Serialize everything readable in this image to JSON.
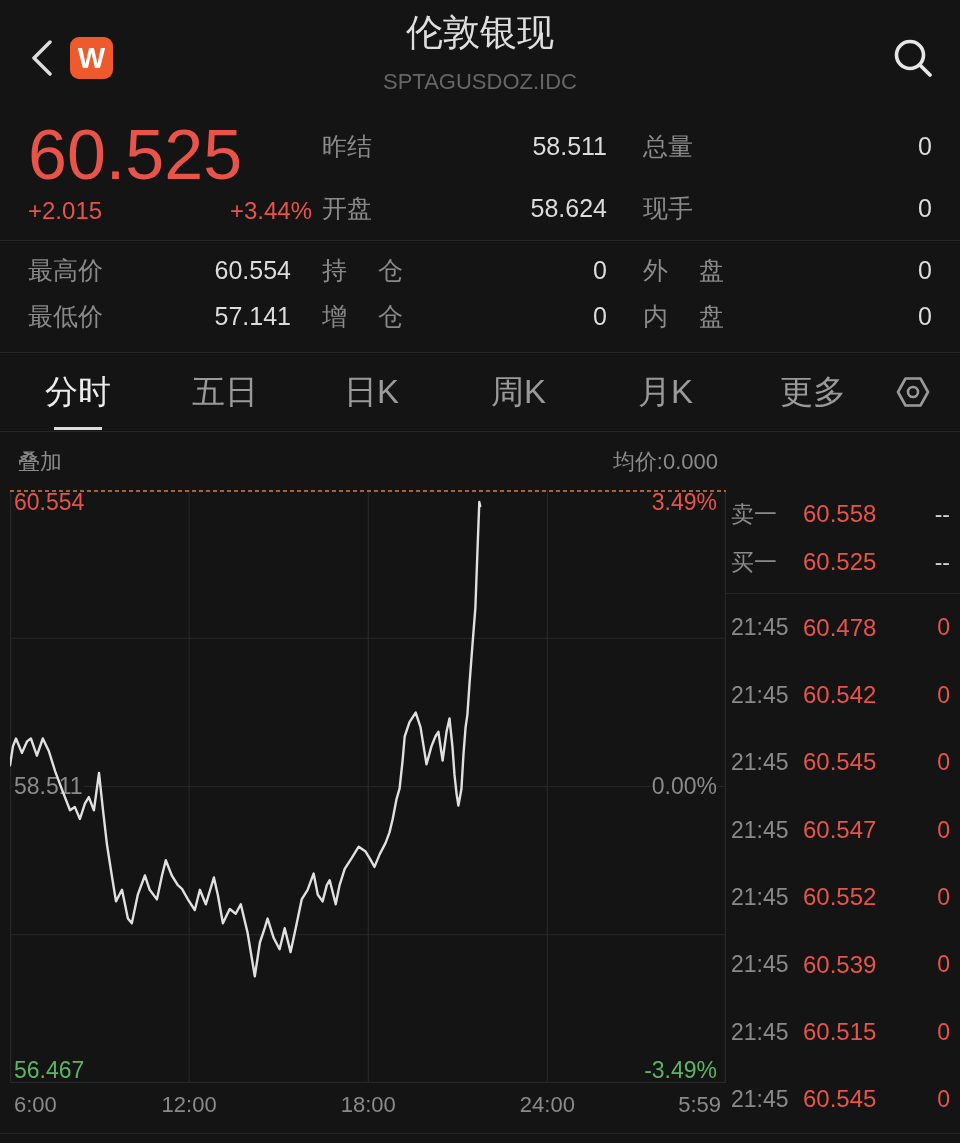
{
  "header": {
    "title": "伦敦银现",
    "subtitle": "SPTAGUSDOZ.IDC",
    "logo_text": "W"
  },
  "quote": {
    "price": "60.525",
    "change": "+2.015",
    "change_percent": "+3.44%",
    "stats": [
      [
        {
          "label": "昨结",
          "value": "58.511"
        },
        {
          "label": "总量",
          "value": "0"
        }
      ],
      [
        {
          "label": "开盘",
          "value": "58.624"
        },
        {
          "label": "现手",
          "value": "0"
        }
      ]
    ]
  },
  "range_stats": [
    [
      {
        "label": "最高价",
        "value": "60.554"
      },
      {
        "label": "持 仓",
        "value": "0"
      },
      {
        "label": "外 盘",
        "value": "0"
      }
    ],
    [
      {
        "label": "最低价",
        "value": "57.141"
      },
      {
        "label": "增 仓",
        "value": "0"
      },
      {
        "label": "内 盘",
        "value": "0"
      }
    ]
  ],
  "tabs": [
    {
      "label": "分时",
      "selected": true
    },
    {
      "label": "五日",
      "selected": false
    },
    {
      "label": "日K",
      "selected": false
    },
    {
      "label": "周K",
      "selected": false
    },
    {
      "label": "月K",
      "selected": false
    },
    {
      "label": "更多",
      "selected": false
    }
  ],
  "chart": {
    "overlay_label": "叠加",
    "average": "均价:0.000",
    "percent_labels": [
      "3.49%",
      "0.00%",
      "-3.49%"
    ],
    "session_end_label": "5:59",
    "chart_data": {
      "type": "line",
      "x": [
        6.0,
        6.1,
        6.2,
        6.4,
        6.57,
        6.7,
        6.9,
        7.1,
        7.3,
        7.51,
        7.74,
        8.01,
        8.17,
        8.34,
        8.51,
        8.64,
        8.81,
        8.98,
        9.11,
        9.25,
        9.41,
        9.55,
        9.75,
        9.95,
        10.08,
        10.28,
        10.52,
        10.68,
        10.92,
        11.09,
        11.22,
        11.42,
        11.62,
        11.76,
        11.96,
        12.19,
        12.36,
        12.56,
        12.83,
        12.96,
        13.13,
        13.36,
        13.56,
        13.73,
        13.96,
        14.2,
        14.37,
        14.53,
        14.63,
        14.83,
        15.03,
        15.2,
        15.4,
        15.57,
        15.77,
        15.97,
        16.17,
        16.31,
        16.47,
        16.61,
        16.71,
        16.91,
        17.04,
        17.21,
        17.44,
        17.68,
        17.91,
        18.05,
        18.21,
        18.38,
        18.58,
        18.71,
        18.82,
        18.95,
        19.05,
        19.15,
        19.22,
        19.38,
        19.59,
        19.75,
        19.95,
        20.12,
        20.25,
        20.35,
        20.49,
        20.62,
        20.72,
        20.82,
        20.89,
        20.96,
        21.02,
        21.12,
        21.19,
        21.26,
        21.32,
        21.39,
        21.49,
        21.59,
        21.66,
        21.72,
        21.75
      ],
      "series": [
        {
          "color": "#e0e0e0",
          "values": [
            58.659,
            58.797,
            58.852,
            58.748,
            58.831,
            58.852,
            58.728,
            58.852,
            58.762,
            58.617,
            58.486,
            58.335,
            58.36,
            58.273,
            58.383,
            58.43,
            58.335,
            58.604,
            58.349,
            58.087,
            57.866,
            57.68,
            57.763,
            57.556,
            57.522,
            57.728,
            57.866,
            57.763,
            57.694,
            57.866,
            57.976,
            57.866,
            57.797,
            57.77,
            57.694,
            57.618,
            57.763,
            57.659,
            57.852,
            57.728,
            57.522,
            57.625,
            57.591,
            57.659,
            57.453,
            57.141,
            57.384,
            57.487,
            57.556,
            57.418,
            57.336,
            57.487,
            57.315,
            57.487,
            57.694,
            57.763,
            57.88,
            57.728,
            57.68,
            57.797,
            57.832,
            57.659,
            57.797,
            57.914,
            57.99,
            58.073,
            58.038,
            57.99,
            57.928,
            58.018,
            58.101,
            58.176,
            58.273,
            58.418,
            58.493,
            58.693,
            58.866,
            58.969,
            59.038,
            58.934,
            58.666,
            58.797,
            58.866,
            58.9,
            58.693,
            58.9,
            58.996,
            58.797,
            58.59,
            58.452,
            58.369,
            58.486,
            58.741,
            58.934,
            59.024,
            59.245,
            59.52,
            59.796,
            60.209,
            60.554,
            60.525
          ]
        }
      ],
      "xlim": [
        6,
        29.983
      ],
      "ylim": [
        56.373,
        60.64
      ],
      "grid": true,
      "xticks": [
        {
          "value": 6,
          "label": "6:00"
        },
        {
          "value": 12,
          "label": "12:00"
        },
        {
          "value": 18,
          "label": "18:00"
        },
        {
          "value": 24,
          "label": "24:00"
        }
      ],
      "yticks": [
        {
          "value": 56.467,
          "label": "56.467"
        },
        {
          "value": 58.511,
          "label": "58.511"
        },
        {
          "value": 60.554,
          "label": "60.554"
        }
      ]
    }
  },
  "order_book": [
    {
      "label": "卖一",
      "price": "60.558",
      "volume": "--"
    },
    {
      "label": "买一",
      "price": "60.525",
      "volume": "--"
    }
  ],
  "trades": [
    {
      "time": "21:45",
      "price": "60.478",
      "volume": "0"
    },
    {
      "time": "21:45",
      "price": "60.542",
      "volume": "0"
    },
    {
      "time": "21:45",
      "price": "60.545",
      "volume": "0"
    },
    {
      "time": "21:45",
      "price": "60.547",
      "volume": "0"
    },
    {
      "time": "21:45",
      "price": "60.552",
      "volume": "0"
    },
    {
      "time": "21:45",
      "price": "60.539",
      "volume": "0"
    },
    {
      "time": "21:45",
      "price": "60.515",
      "volume": "0"
    },
    {
      "time": "21:45",
      "price": "60.545",
      "volume": "0"
    }
  ]
}
